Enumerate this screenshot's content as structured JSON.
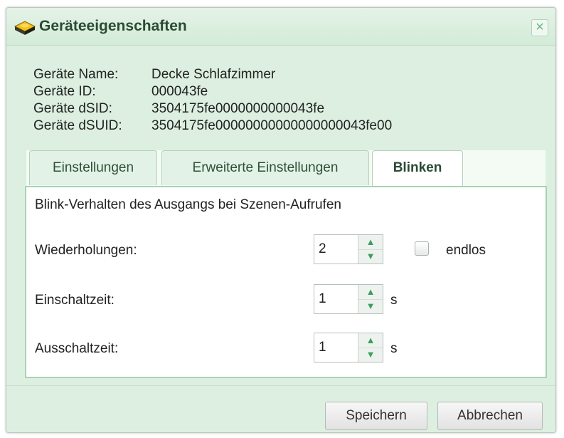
{
  "window": {
    "title": "Geräteeigenschaften",
    "icon": "device-icon",
    "close_glyph": "×"
  },
  "info": {
    "rows": [
      {
        "label": "Geräte Name:",
        "value": "Decke Schlafzimmer"
      },
      {
        "label": "Geräte ID:",
        "value": "000043fe"
      },
      {
        "label": "Geräte dSID:",
        "value": "3504175fe0000000000043fe"
      },
      {
        "label": "Geräte dSUID:",
        "value": "3504175fe00000000000000000043fe00"
      }
    ]
  },
  "tabs": [
    {
      "label": "Einstellungen",
      "active": false
    },
    {
      "label": "Erweiterte Einstellungen",
      "active": false
    },
    {
      "label": "Blinken",
      "active": true
    }
  ],
  "panel": {
    "description": "Blink-Verhalten des Ausgangs bei Szenen-Aufrufen",
    "repetitions": {
      "label": "Wiederholungen:",
      "value": "2",
      "endless_label": "endlos",
      "endless_checked": false
    },
    "on_time": {
      "label": "Einschaltzeit:",
      "value": "1",
      "unit": "s"
    },
    "off_time": {
      "label": "Ausschaltzeit:",
      "value": "1",
      "unit": "s"
    }
  },
  "buttons": {
    "save": "Speichern",
    "cancel": "Abbrechen"
  },
  "colors": {
    "dialog_bg": "#dcefe0",
    "accent_green": "#3f9d5d",
    "panel_border": "#a9d2b2"
  }
}
